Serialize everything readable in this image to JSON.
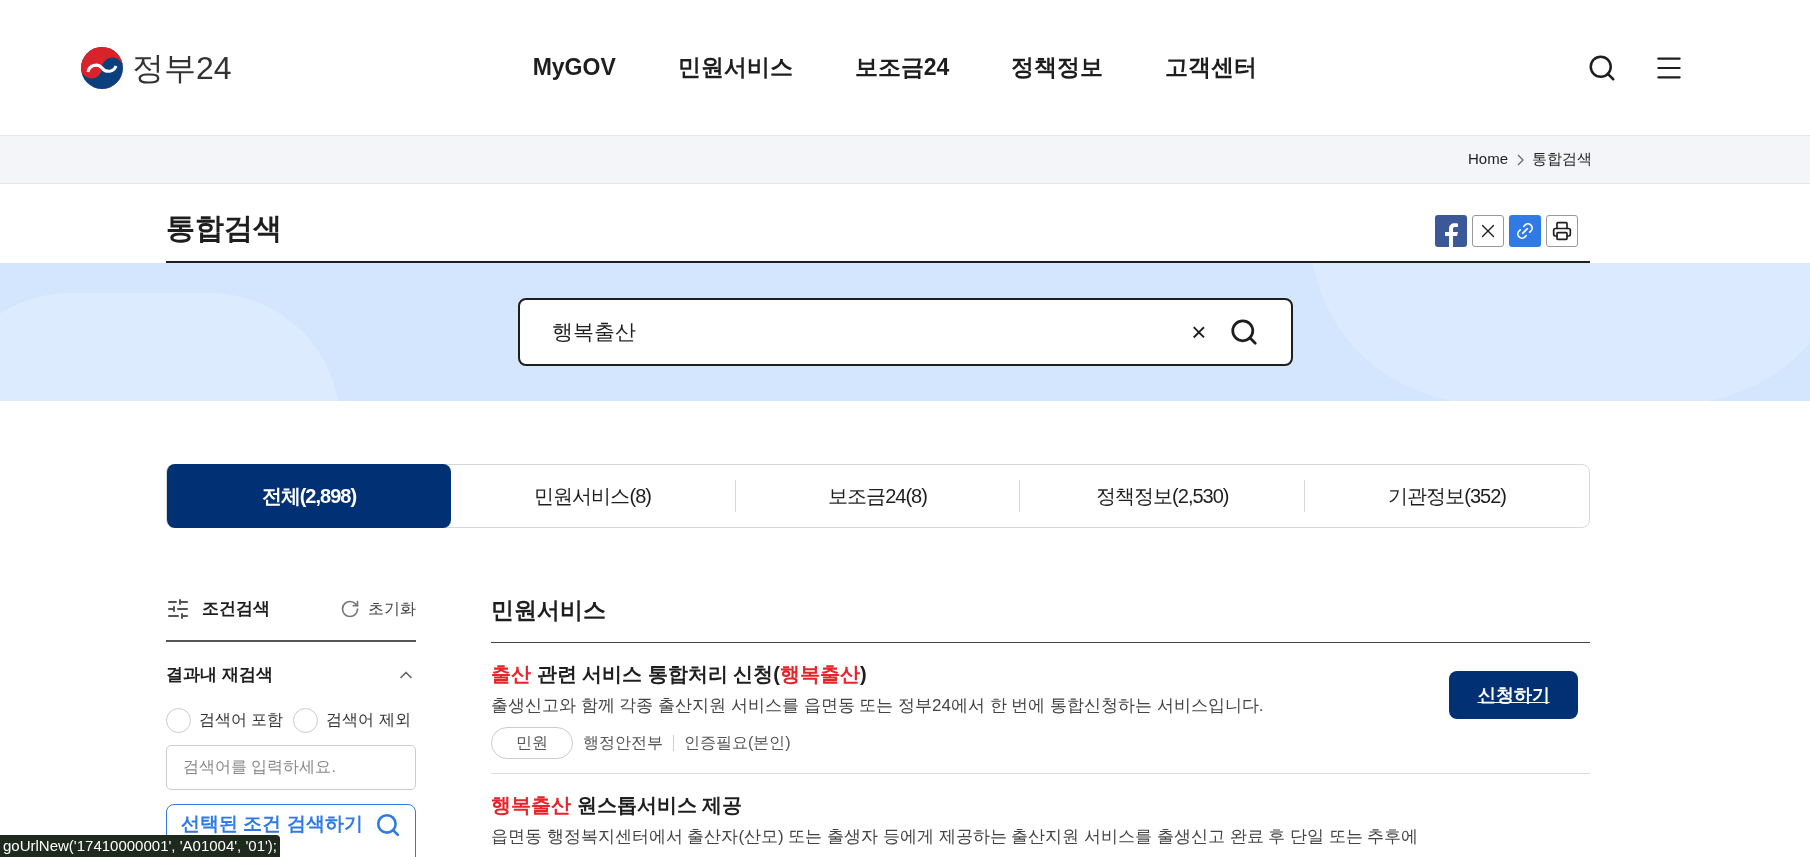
{
  "header": {
    "logo": "정부24",
    "nav": [
      "MyGOV",
      "민원서비스",
      "보조금24",
      "정책정보",
      "고객센터"
    ]
  },
  "breadcrumb": [
    "Home",
    "통합검색"
  ],
  "page_title": "통합검색",
  "search": {
    "value": "행복출산",
    "clear": "×"
  },
  "tabs": [
    {
      "label": "전체(2,898)",
      "selected": true
    },
    {
      "label": "민원서비스(8)",
      "selected": false
    },
    {
      "label": "보조금24(8)",
      "selected": false
    },
    {
      "label": "정책정보(2,530)",
      "selected": false
    },
    {
      "label": "기관정보(352)",
      "selected": false
    }
  ],
  "sidebar": {
    "title": "조건검색",
    "reset": "초기화",
    "section": {
      "title": "결과내 재검색",
      "expanded": true
    },
    "options": [
      {
        "label": "검색어 포함",
        "selected": false
      },
      {
        "label": "검색어 제외",
        "selected": false
      }
    ],
    "field": {
      "placeholder": "검색어를 입력하세요."
    },
    "submit": "선택된 조건 검색하기"
  },
  "results": {
    "heading": "민원서비스",
    "items": [
      {
        "title": [
          {
            "text": "출산",
            "highlight": true
          },
          {
            "text": " 관련 서비스 통합처리 신청(",
            "highlight": false
          },
          {
            "text": "행복출산",
            "highlight": true
          },
          {
            "text": ")",
            "highlight": false
          }
        ],
        "description": "출생신고와 함께 각종 출산지원 서비스를 읍면동 또는 정부24에서 한 번에 통합신청하는 서비스입니다.",
        "tag": "민원",
        "agency": "행정안전부",
        "auth": "인증필요(본인)",
        "action": "신청하기"
      },
      {
        "title": [
          {
            "text": "행복출산",
            "highlight": true
          },
          {
            "text": " 원스톱서비스 제공",
            "highlight": false
          }
        ],
        "description": "읍면동 행정복지센터에서 출산자(산모) 또는 출생자 등에게 제공하는 출산지원 서비스를 출생신고 완료 후 단일 또는 추후에"
      }
    ]
  },
  "status_bar": "goUrlNew('17410000001', 'A01004', '01');"
}
